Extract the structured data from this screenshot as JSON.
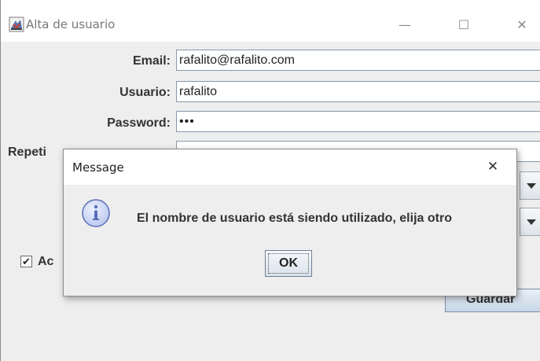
{
  "window": {
    "title": "Alta de usuario",
    "controls": {
      "minimize": "—",
      "maximize": "☐",
      "close": "✕"
    }
  },
  "form": {
    "email_label": "Email:",
    "email_value": "rafalito@rafalito.com",
    "user_label": "Usuario:",
    "user_value": "rafalito",
    "password_label": "Password:",
    "password_value": "•••",
    "repeat_label": "Repeti",
    "accept_label": "Ac",
    "accept_checked": true,
    "checkbox_glyph": "✔",
    "save_label": "Guardar"
  },
  "dialog": {
    "title": "Message",
    "close_glyph": "✕",
    "message": "El nombre de usuario está siendo utilizado, elija otro",
    "ok_label": "OK",
    "icon": "information-icon"
  },
  "colors": {
    "window_bg": "#eeeeee",
    "titlebar_bg": "#ffffff",
    "field_border": "#8a98a8",
    "info_icon_fill": "#c9d3f2",
    "info_icon_stroke": "#5a6fb8"
  }
}
